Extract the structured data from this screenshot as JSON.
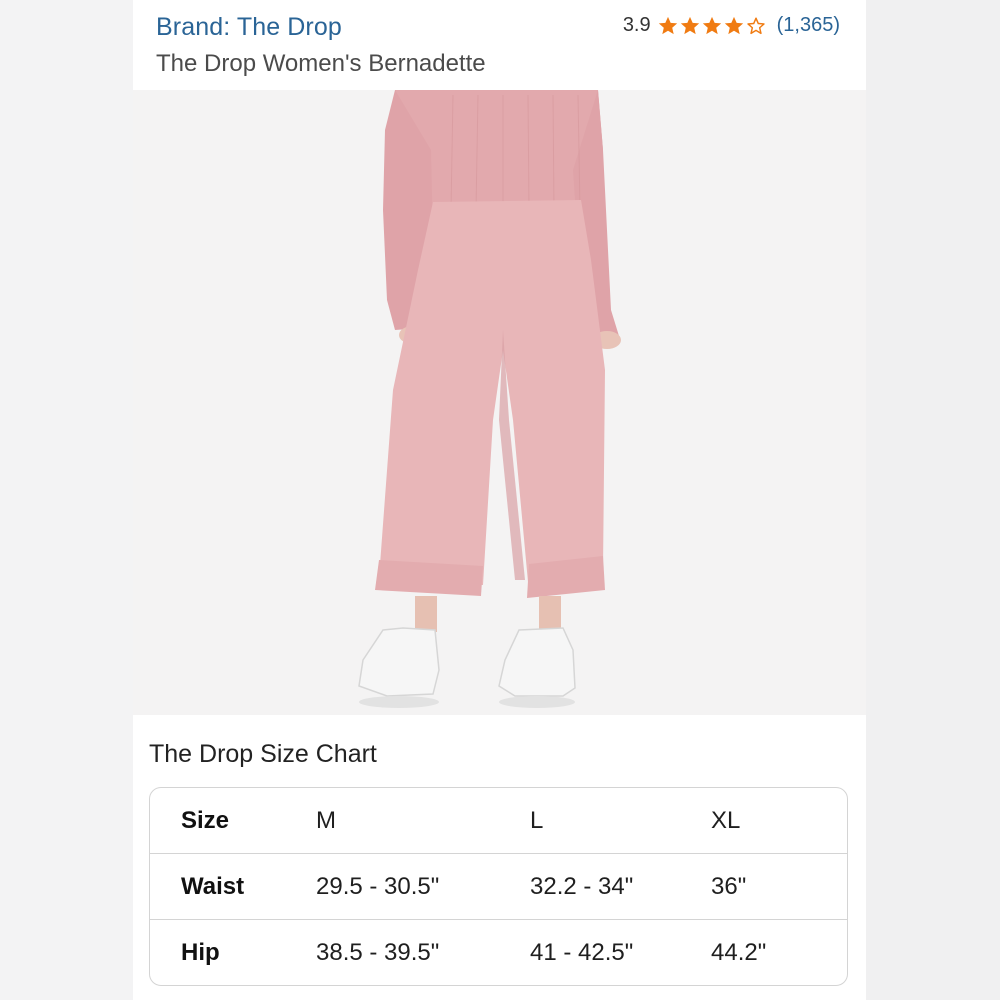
{
  "header": {
    "brand": "Brand: The Drop",
    "title": "The Drop Women's Bernadette",
    "rating_value": "3.9",
    "rating": 3.9,
    "star_icons": [
      "star-full",
      "star-full",
      "star-full",
      "star-full",
      "star-empty"
    ],
    "review_count": "(1,365)"
  },
  "product_image": {
    "description_icon": "product-photo",
    "colors": {
      "garment": "#e7b4b6",
      "shoe": "#f4f4f4"
    }
  },
  "size_chart": {
    "title": "The Drop Size Chart",
    "rows": [
      {
        "label": "Size",
        "values": [
          "M",
          "L",
          "XL"
        ]
      },
      {
        "label": "Waist",
        "values": [
          "29.5 - 30.5\"",
          "32.2 - 34\"",
          "36\""
        ]
      },
      {
        "label": "Hip",
        "values": [
          "38.5 - 39.5\"",
          "41 - 42.5\"",
          "44.2\""
        ]
      }
    ]
  },
  "colors": {
    "link": "#2a6496",
    "star": "#f07b12",
    "border": "#d4d4d4"
  }
}
